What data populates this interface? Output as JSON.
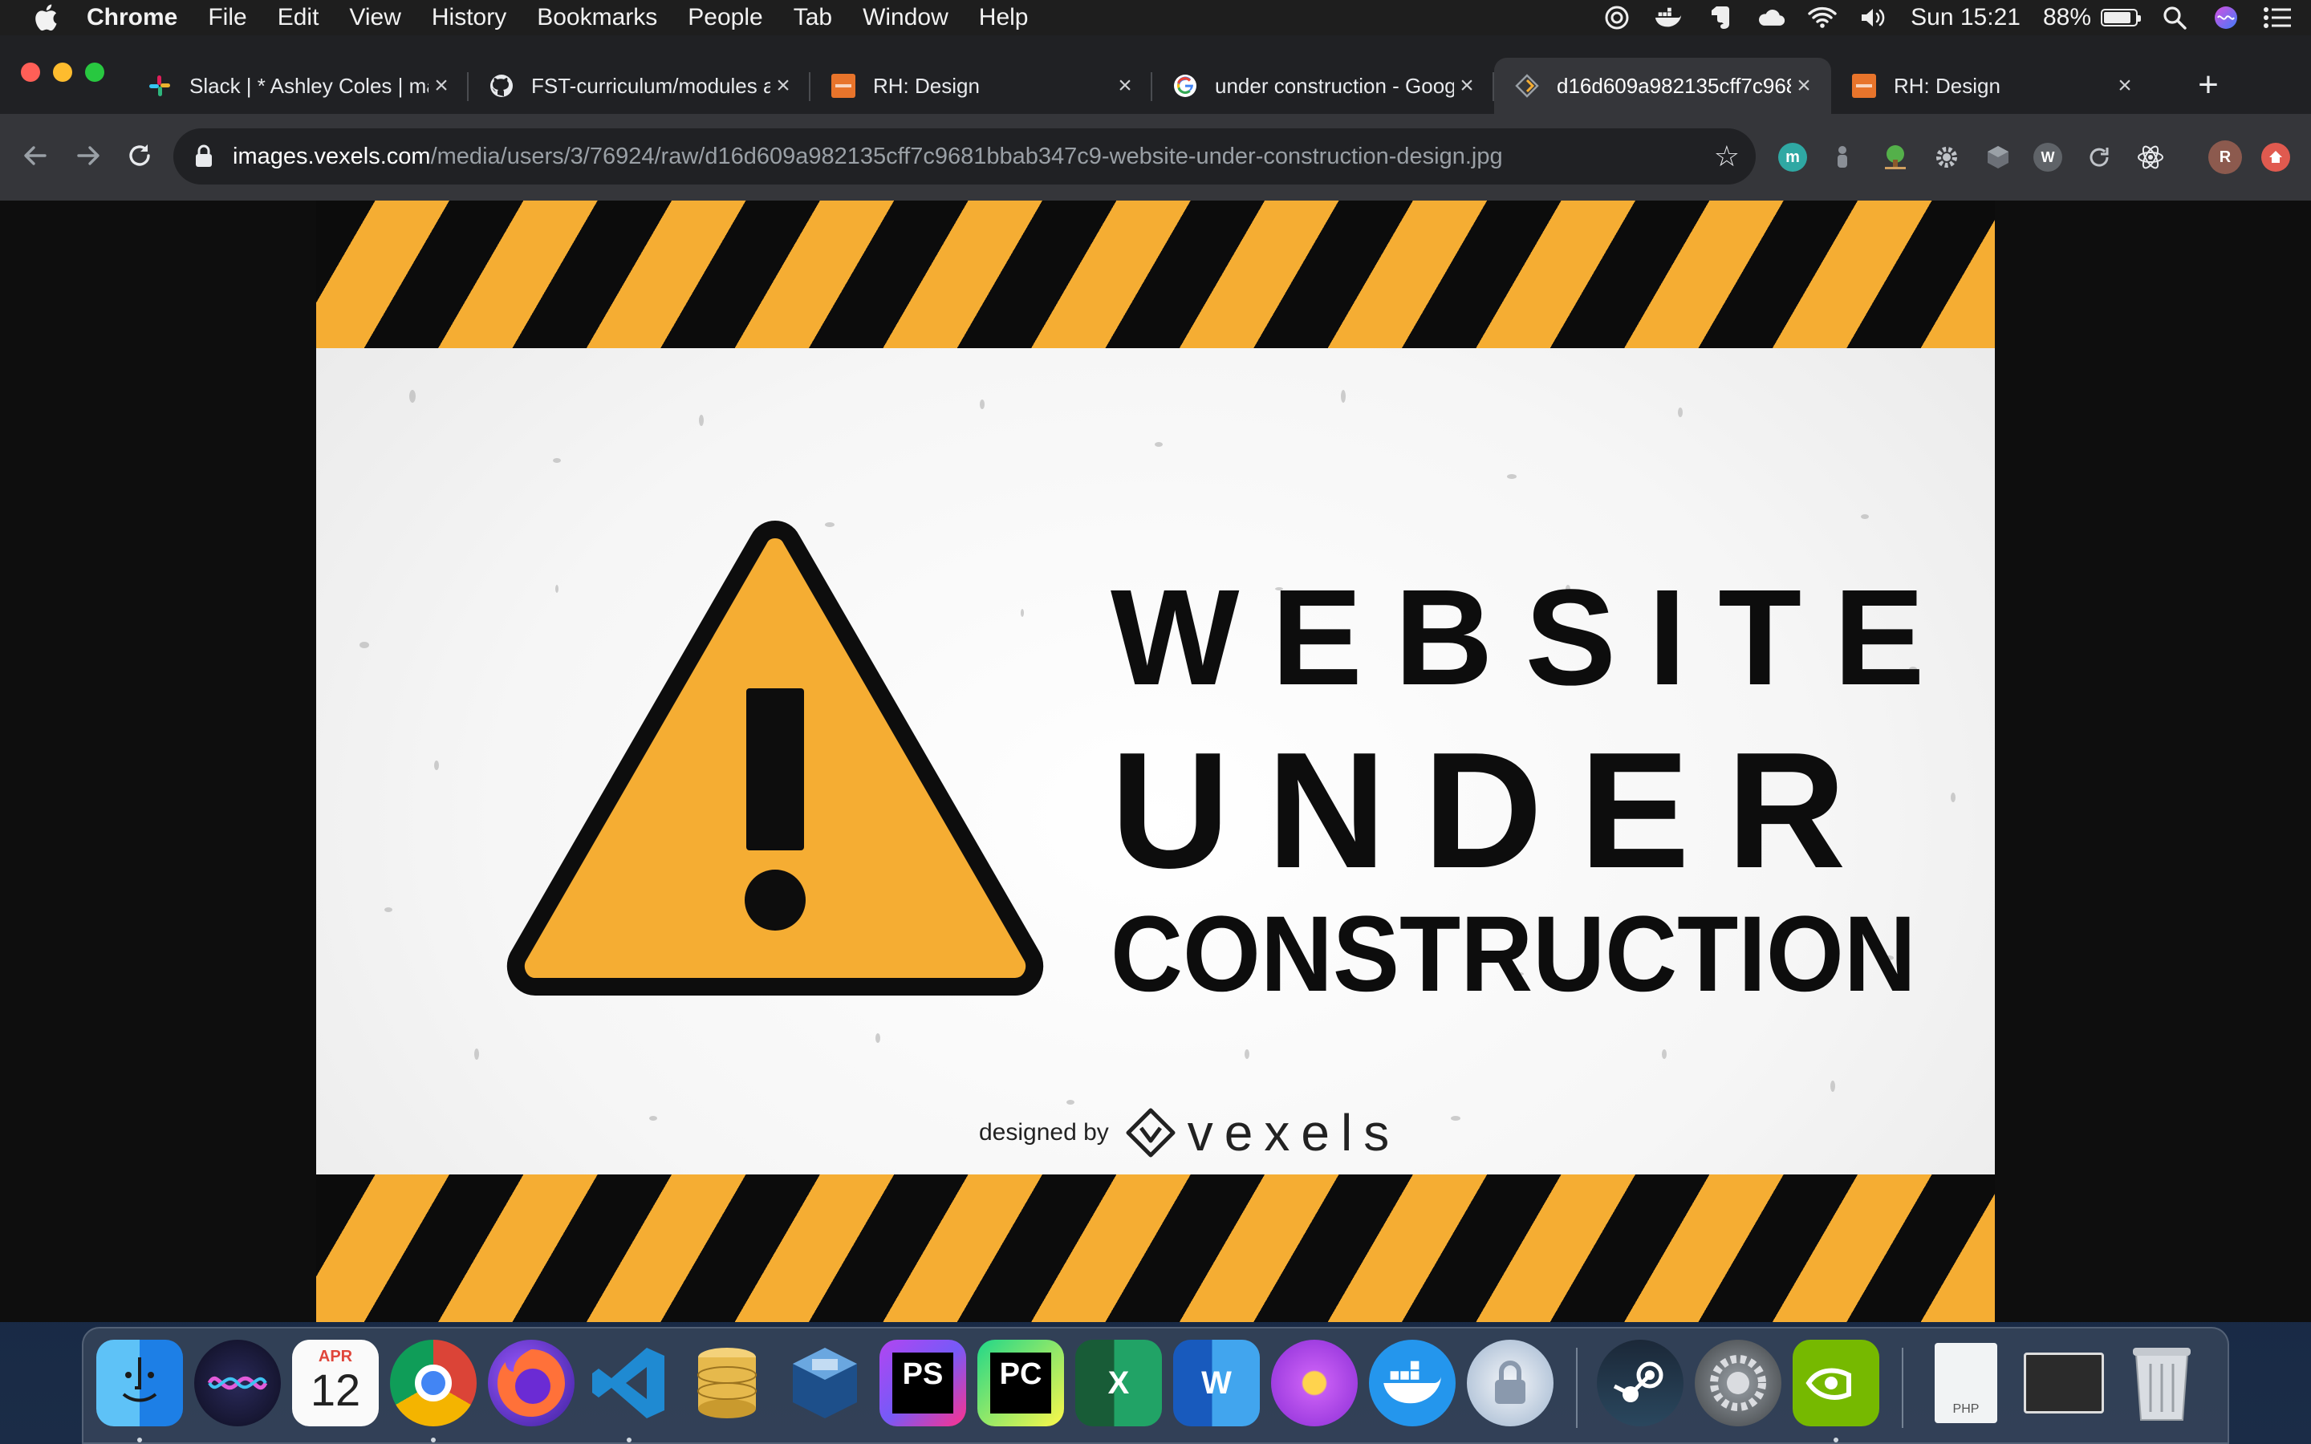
{
  "menubar": {
    "app_name": "Chrome",
    "menus": [
      "File",
      "Edit",
      "View",
      "History",
      "Bookmarks",
      "People",
      "Tab",
      "Window",
      "Help"
    ],
    "clock": "Sun 15:21",
    "battery_text": "88%",
    "battery_level": 0.88
  },
  "tabs": [
    {
      "title": "Slack | * Ashley Coles | may",
      "icon": "slack-icon"
    },
    {
      "title": "FST-curriculum/modules at",
      "icon": "github-icon"
    },
    {
      "title": "RH: Design",
      "icon": "rh-design-icon"
    },
    {
      "title": "under construction - Googl",
      "icon": "google-icon"
    },
    {
      "title": "d16d609a982135cff7c968",
      "icon": "image-favicon-icon",
      "active": true
    },
    {
      "title": "RH: Design",
      "icon": "rh-design-icon"
    }
  ],
  "address_bar": {
    "host": "images.vexels.com",
    "path": "/media/users/3/76924/raw/d16d609a982135cff7c9681bbab347c9-website-under-construction-design.jpg"
  },
  "profile_initial": "R",
  "poster": {
    "line1": "WEBSITE",
    "line2": "UNDER",
    "line3": "CONSTRUCTION",
    "credit_prefix": "designed by",
    "brand": "vexels",
    "colors": {
      "hazard_yellow": "#f5ad33",
      "hazard_black": "#0c0c0c",
      "sign_fill": "#f5ad33"
    }
  },
  "dock": {
    "apps": [
      "Finder",
      "Siri",
      "Calendar",
      "Google Chrome",
      "Firefox",
      "Visual Studio Code",
      "Sequel Pro",
      "VirtualBox",
      "PhpStorm",
      "PyCharm",
      "Microsoft Excel",
      "Microsoft Word",
      "Flower",
      "Docker",
      "Keychain",
      "Steam",
      "System Preferences",
      "NVIDIA",
      "PHP Document",
      "Screenshot",
      "Trash"
    ],
    "calendar_month": "APR",
    "calendar_day": "12",
    "php_label": "PHP"
  }
}
